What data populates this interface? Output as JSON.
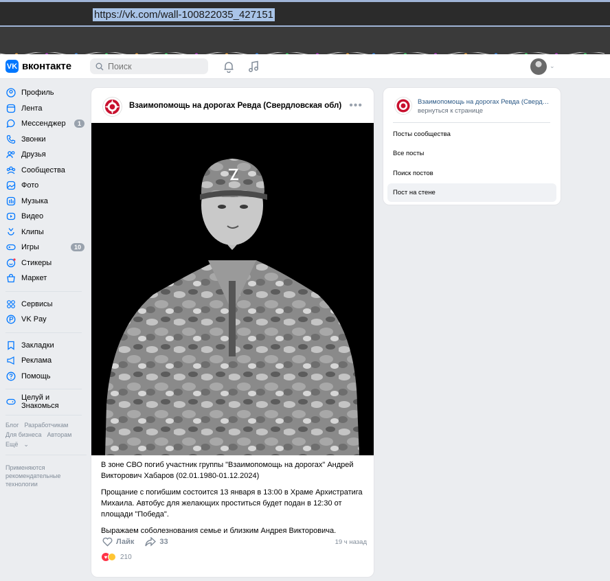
{
  "browser": {
    "url": "https://vk.com/wall-100822035_427151"
  },
  "header": {
    "logo_text": "вконтакте",
    "logo_mark": "VK",
    "search_placeholder": "Поиск",
    "icons": [
      "bell-icon",
      "music-icon"
    ]
  },
  "sidebar": {
    "items": [
      {
        "label": "Профиль",
        "icon": "user-icon"
      },
      {
        "label": "Лента",
        "icon": "feed-icon"
      },
      {
        "label": "Мессенджер",
        "icon": "messenger-icon",
        "badge": "1"
      },
      {
        "label": "Звонки",
        "icon": "phone-icon"
      },
      {
        "label": "Друзья",
        "icon": "friends-icon"
      },
      {
        "label": "Сообщества",
        "icon": "communities-icon"
      },
      {
        "label": "Фото",
        "icon": "photo-icon"
      },
      {
        "label": "Музыка",
        "icon": "music-icon"
      },
      {
        "label": "Видео",
        "icon": "video-icon"
      },
      {
        "label": "Клипы",
        "icon": "clips-icon"
      },
      {
        "label": "Игры",
        "icon": "games-icon",
        "badge": "10"
      },
      {
        "label": "Стикеры",
        "icon": "stickers-icon"
      },
      {
        "label": "Маркет",
        "icon": "market-icon"
      }
    ],
    "items2": [
      {
        "label": "Сервисы",
        "icon": "services-icon"
      },
      {
        "label": "VK Pay",
        "icon": "vkpay-icon"
      }
    ],
    "items3": [
      {
        "label": "Закладки",
        "icon": "bookmark-icon"
      },
      {
        "label": "Реклама",
        "icon": "ads-icon"
      },
      {
        "label": "Помощь",
        "icon": "help-icon"
      }
    ],
    "items4": [
      {
        "label": "Целуй и Знакомься",
        "icon": "gamepad-icon"
      }
    ],
    "footer": {
      "row1": [
        "Блог",
        "Разработчикам"
      ],
      "row2": [
        "Для бизнеса",
        "Авторам"
      ],
      "more": "Ещё",
      "recommend": [
        "Применяются",
        "рекомендательные",
        "технологии"
      ]
    }
  },
  "post": {
    "group_name": "Взаимопомощь на дорогах Ревда (Свердловская обл)",
    "paragraphs": [
      "В зоне СВО погиб участник группы \"Взаимопомощь на дорогах\" Андрей Викторович Хабаров (02.01.1980-01.12.2024)",
      "Прощание с погибшим состоится 13 января в 13:00 в Храме Архистратига Михаила. Автобус для желающих проститься будет подан в 12:30 от площади \"Победа\".",
      "Выражаем соболезнования семье и близким Андрея Викторовича."
    ],
    "like_label": "Лайк",
    "share_count": "33",
    "time": "19 ч назад",
    "reactions_count": "210"
  },
  "right_panel": {
    "group_name": "Взаимопомощь на дорогах Ревда (Свердловская обл)",
    "back_label": "вернуться к странице",
    "items": [
      {
        "label": "Посты сообщества",
        "active": false
      },
      {
        "label": "Все посты",
        "active": false
      },
      {
        "label": "Поиск постов",
        "active": false
      },
      {
        "label": "Пост на стене",
        "active": true
      }
    ]
  },
  "colors": {
    "accent": "#0077ff",
    "link": "#2a5885",
    "muted": "#818c99",
    "page_bg": "#ebedf0"
  }
}
